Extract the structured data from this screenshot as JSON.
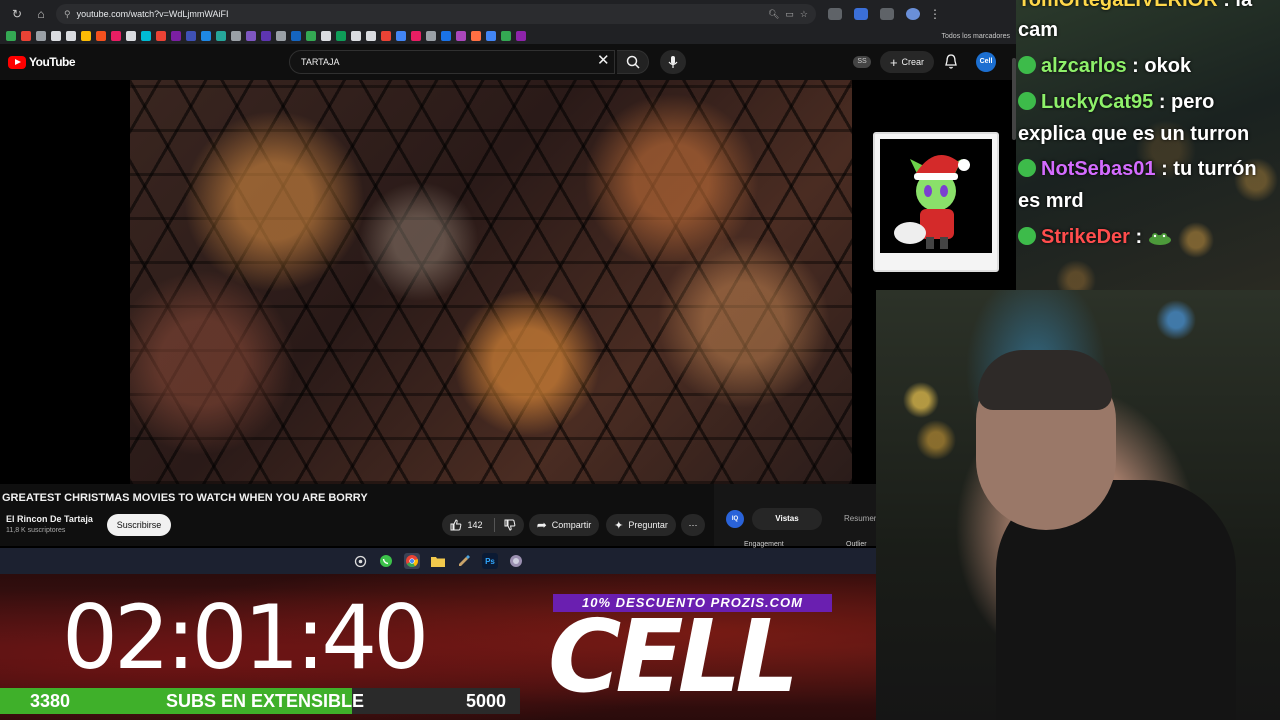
{
  "browser": {
    "url": "youtube.com/watch?v=WdLjmmWAiFI",
    "bookmarks_all_label": "Todos los marcadores",
    "bookmark_colors": [
      "#34a853",
      "#ea4335",
      "#9aa0a6",
      "#dadce0",
      "#dadce0",
      "#fbbc05",
      "#f4511e",
      "#e91e63",
      "#dadce0",
      "#00bcd4",
      "#ea4335",
      "#7b1fa2",
      "#3f51b5",
      "#1e88e5",
      "#26a69a",
      "#9aa0a6",
      "#7e57c2",
      "#5e35b1",
      "#9aa0a6",
      "#1565c0",
      "#34a853",
      "#dadce0",
      "#0f9d58",
      "#dadce0",
      "#dadce0",
      "#ea4335",
      "#4285f4",
      "#e91e63",
      "#9aa0a6",
      "#1a73e8",
      "#ab47bc",
      "#ff7043",
      "#4285f4",
      "#34a853",
      "#8e24aa"
    ]
  },
  "youtube": {
    "logo_text": "YouTube",
    "search_query": "TARTAJA",
    "ss_badge": "SS",
    "create_label": "Crear",
    "avatar_text": "Cell",
    "video": {
      "title": "GREATEST CHRISTMAS MOVIES TO WATCH WHEN YOU ARE BORRY",
      "channel": "El Rincon De Tartaja",
      "subscribers": "11,8 K suscriptores",
      "subscribe_label": "Suscribirse",
      "likes": "142",
      "share_label": "Compartir",
      "ask_label": "Preguntar",
      "more_label": "⋯"
    },
    "extension": {
      "iq_label": "IQ",
      "tab_active": "Vistas",
      "tab_other": "Resumen",
      "engagement": "Engagement",
      "outlier": "Outlier"
    }
  },
  "taskbar": {
    "icons": [
      "settings-icon",
      "whatsapp-icon",
      "chrome-icon",
      "file-explorer-icon",
      "notepad-icon",
      "photoshop-icon",
      "app-icon"
    ]
  },
  "stream_overlay": {
    "timer": "02:01:40",
    "promo": "10% DESCUENTO PROZIS.COM",
    "brand": "CELL",
    "subs_current": "3380",
    "subs_label": "SUBS EN EXTENSIBLE",
    "subs_goal": "5000",
    "subs_progress": 0.676
  },
  "chat": {
    "messages": [
      {
        "user": "TomOrtegaLIVERIOR",
        "text": ": la",
        "color": "#ffd84a",
        "wrap": "cam"
      },
      {
        "user": "alzcarlos",
        "text": ": okok",
        "color": "#8ef06a"
      },
      {
        "user": "LuckyCat95",
        "text": ": pero",
        "color": "#8ef06a",
        "wrap": "explica que es un turron"
      },
      {
        "user": "NotSebas01",
        "text": ": tu turrón",
        "color": "#d46cff",
        "wrap": "es mrd"
      },
      {
        "user": "StrikeDer",
        "text": ":",
        "color": "#ff4d4d"
      }
    ]
  }
}
